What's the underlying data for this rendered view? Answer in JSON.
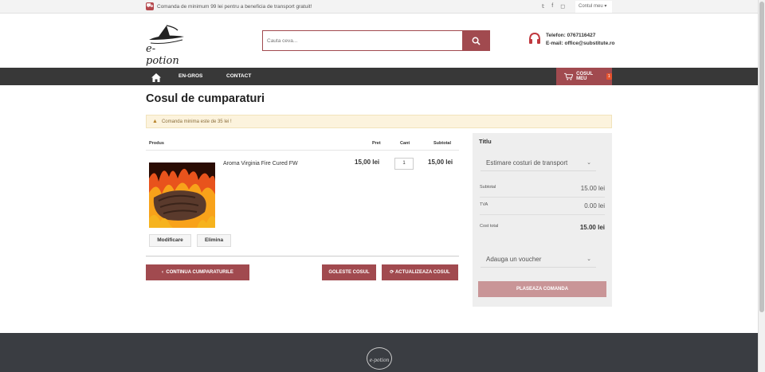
{
  "topbar": {
    "promo_text": "Comanda de minimum 99 lei pentru a beneficia de transport gratuit!",
    "social_icons": [
      "twitter-icon",
      "facebook-icon",
      "instagram-icon"
    ],
    "account_label": "Contul meu"
  },
  "header": {
    "logo_text": "e-potion",
    "search_placeholder": "Cauta ceva...",
    "phone_line": "Telefon: 0767116427",
    "email_line": "E-mail: office@substitute.ro"
  },
  "nav": {
    "items": [
      "EN-GROS",
      "CONTACT"
    ],
    "cart_label": "COSUL MEU",
    "cart_count": "1"
  },
  "page": {
    "title": "Cosul de cumparaturi",
    "alert": "Comanda minima este de 35 lei !"
  },
  "cart": {
    "headers": {
      "product": "Produs",
      "price": "Pret",
      "qty": "Cant",
      "subtotal": "Subtotal"
    },
    "items": [
      {
        "name": "Aroma Virginia Fire Cured FW",
        "price": "15,00 lei",
        "qty": "1",
        "subtotal": "15,00 lei"
      }
    ],
    "modify_label": "Modificare",
    "remove_label": "Elimina",
    "continue_label": "CONTINUA CUMPARATURILE",
    "empty_label": "GOLESTE COSUL",
    "update_label": "ACTUALIZEAZA COSUL"
  },
  "summary": {
    "title": "Titlu",
    "shipping_select": "Estimare costuri de transport",
    "subtotal_label": "Subtotal",
    "subtotal_value": "15.00 lei",
    "vat_label": "TVA",
    "vat_value": "0.00 lei",
    "total_label": "Cost total",
    "total_value": "15.00 lei",
    "voucher_select": "Adauga un voucher",
    "place_order_label": "PLASEAZA COMANDA"
  },
  "footer": {
    "logo_text": "e-potion"
  },
  "colors": {
    "accent": "#a14a4f",
    "nav_bg": "#383838",
    "footer_bg": "#3a3d42"
  }
}
